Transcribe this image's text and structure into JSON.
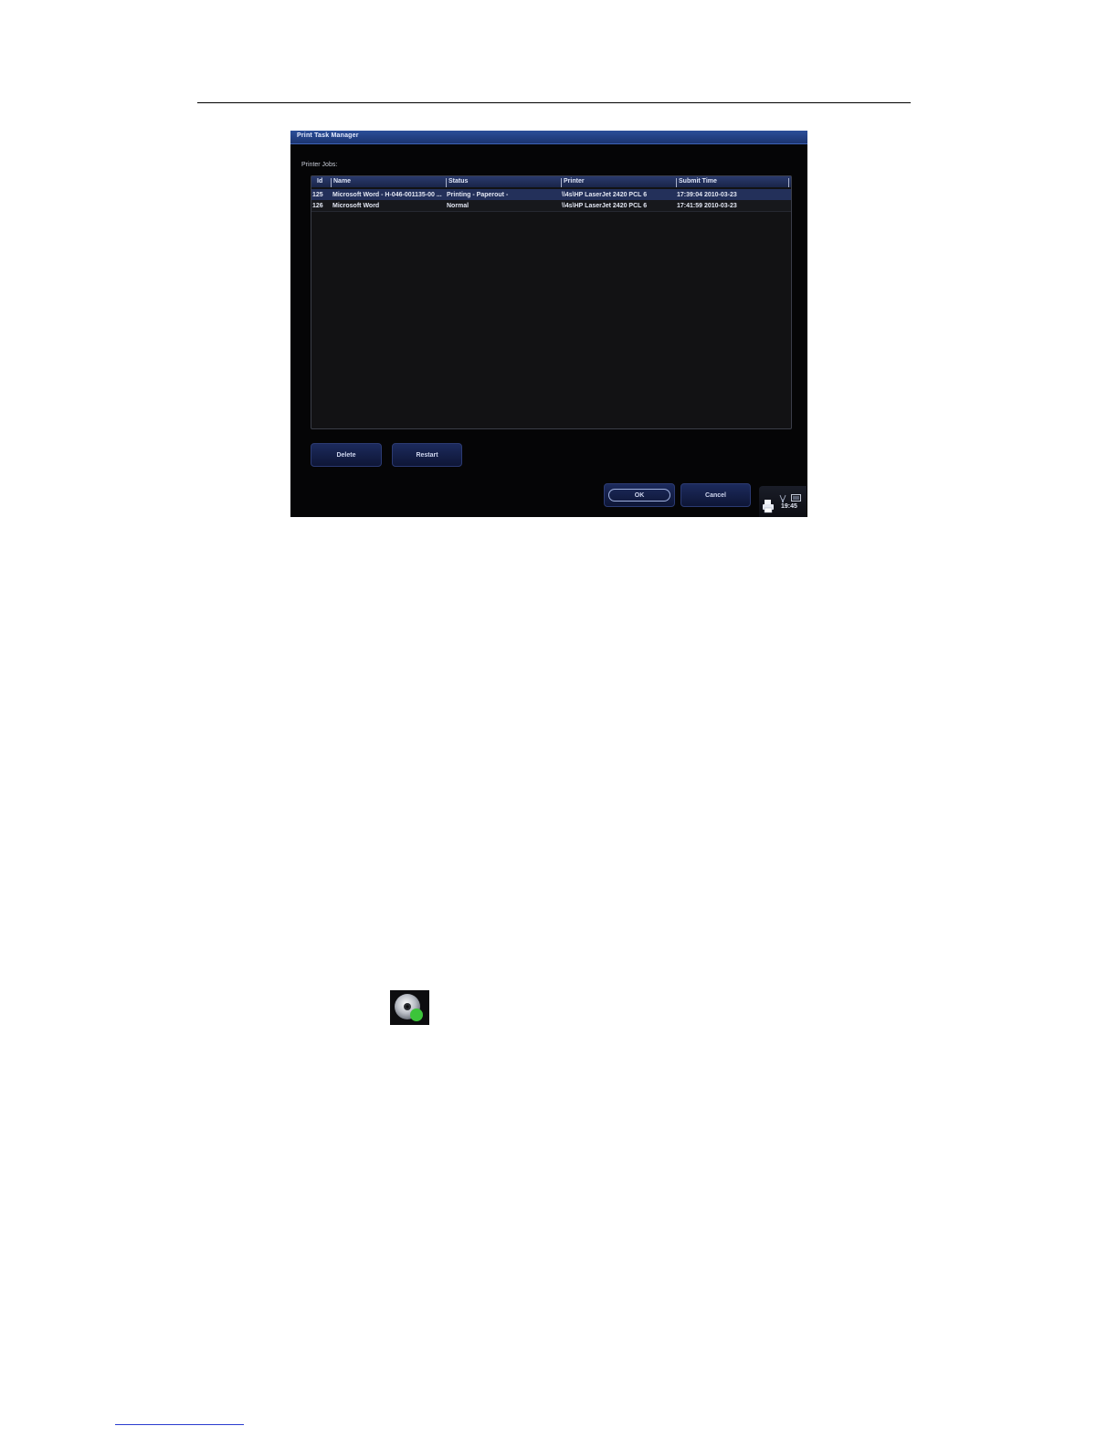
{
  "dialog": {
    "title": "Print Task Manager",
    "jobs_label": "Printer Jobs:",
    "columns": [
      "Id",
      "Name",
      "Status",
      "Printer",
      "Submit Time"
    ],
    "rows": [
      {
        "id": "125",
        "name": "Microsoft Word - H-046-001135-00 ...",
        "status": "Printing - Paperout -",
        "printer": "\\\\4s\\HP LaserJet 2420 PCL 6",
        "submit_time": "17:39:04  2010-03-23"
      },
      {
        "id": "126",
        "name": "Microsoft Word",
        "status": "Normal",
        "printer": "\\\\4s\\HP LaserJet 2420 PCL 6",
        "submit_time": "17:41:59  2010-03-23"
      }
    ],
    "buttons": {
      "delete": "Delete",
      "restart": "Restart",
      "ok": "OK",
      "cancel": "Cancel"
    },
    "tray": {
      "time": "19:45",
      "icons": [
        "printer-icon",
        "usb-icon",
        "monitor-icon"
      ]
    }
  },
  "colors": {
    "title_bar": "#1b3470",
    "dialog_bg": "#050506",
    "selected_row": "#23305a",
    "button": "#1c2a5c"
  },
  "page_icons": [
    "disc-icon"
  ]
}
